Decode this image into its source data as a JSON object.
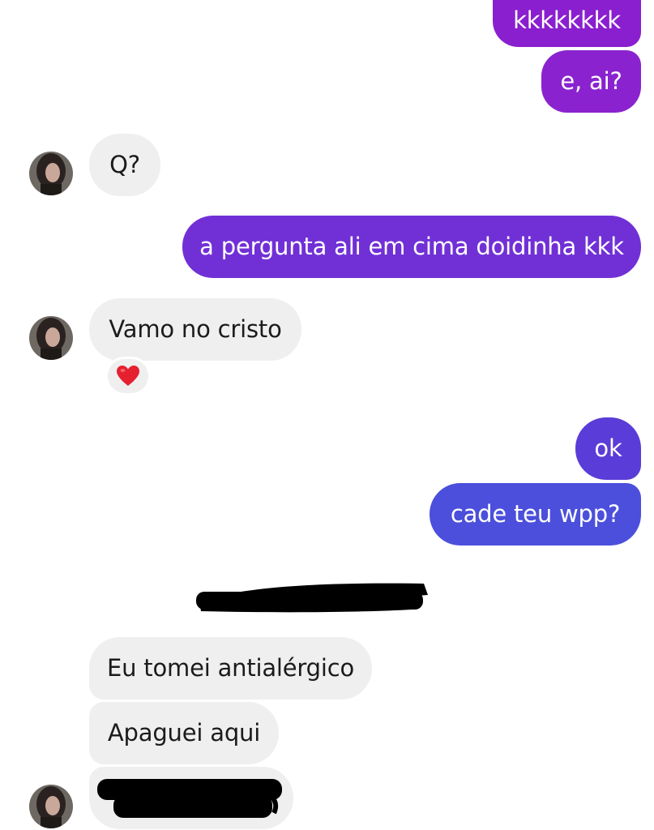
{
  "colors": {
    "sent_purple": "#8a1fcf",
    "sent_indigo": "#5b3fd9",
    "received_bg": "#efefef",
    "redaction": "#000000",
    "reaction_heart": "#e5202f"
  },
  "messages": [
    {
      "id": "m1",
      "from": "me",
      "text": "kkkkkkkk"
    },
    {
      "id": "m2",
      "from": "me",
      "text": "e, ai?"
    },
    {
      "id": "m3",
      "from": "them",
      "text": "Q?"
    },
    {
      "id": "m4",
      "from": "me",
      "text": "a pergunta ali em cima doidinha kkk"
    },
    {
      "id": "m5",
      "from": "them",
      "text": "Vamo no cristo",
      "reaction": "heart-icon"
    },
    {
      "id": "m6",
      "from": "me",
      "text": "ok"
    },
    {
      "id": "m7",
      "from": "me",
      "text": "cade teu wpp?"
    },
    {
      "id": "m8",
      "from": "them",
      "redacted": true
    },
    {
      "id": "m9",
      "from": "them",
      "text": "Eu tomei antialérgico"
    },
    {
      "id": "m10",
      "from": "them",
      "text": "Apaguei aqui"
    },
    {
      "id": "m11",
      "from": "them",
      "redacted": true
    }
  ]
}
